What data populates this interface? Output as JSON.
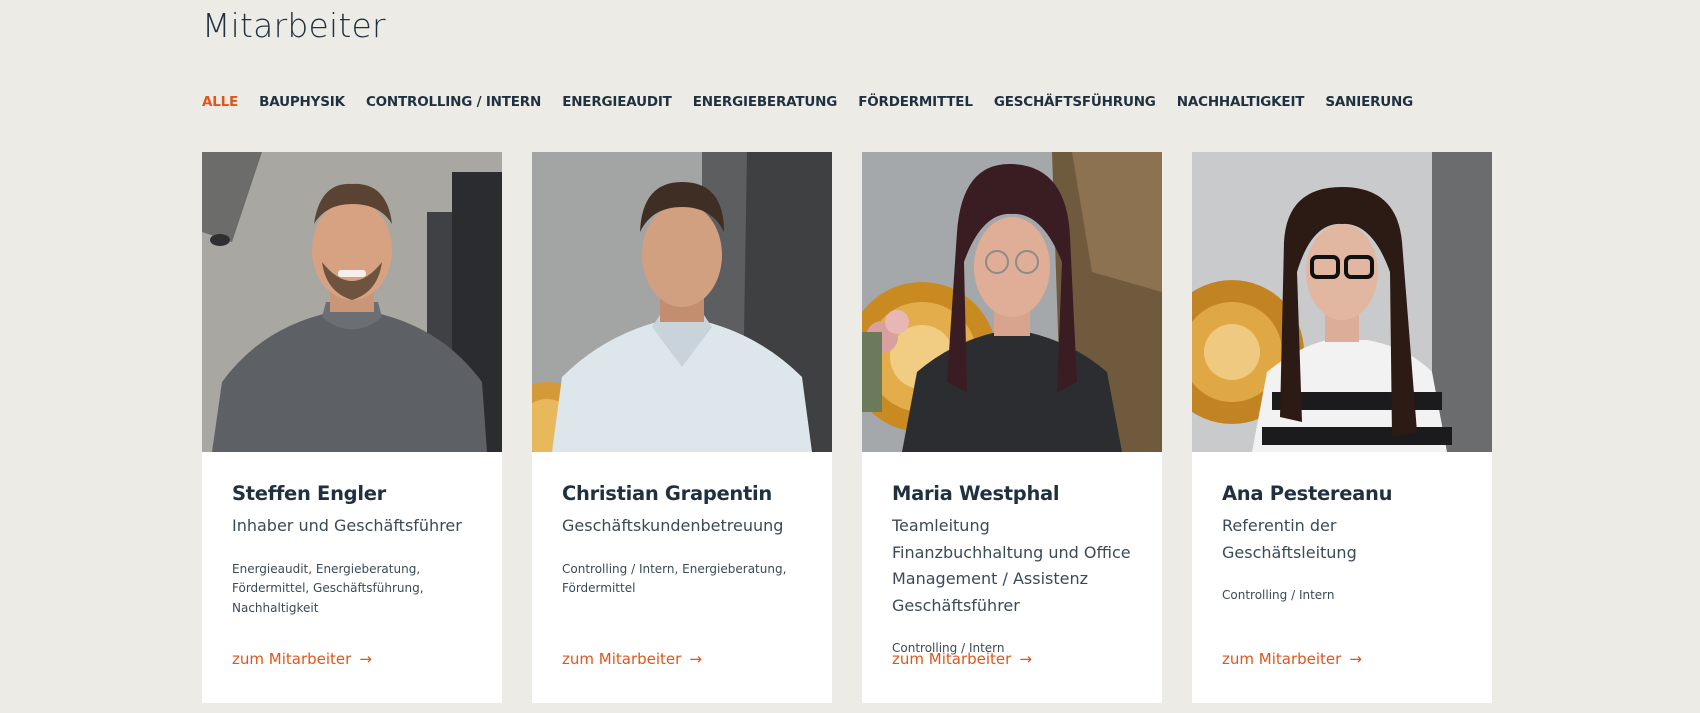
{
  "page": {
    "title": "Mitarbeiter"
  },
  "filters": [
    {
      "label": "ALLE",
      "active": true
    },
    {
      "label": "BAUPHYSIK"
    },
    {
      "label": "CONTROLLING / INTERN"
    },
    {
      "label": "ENERGIEAUDIT"
    },
    {
      "label": "ENERGIEBERATUNG"
    },
    {
      "label": "FÖRDERMITTEL"
    },
    {
      "label": "GESCHÄFTSFÜHRUNG"
    },
    {
      "label": "NACHHALTIGKEIT"
    },
    {
      "label": "SANIERUNG"
    }
  ],
  "employees": [
    {
      "name": "Steffen Engler",
      "role": "Inhaber und Geschäftsführer",
      "tags": "Energieaudit, Energieberatung, Fördermittel, Geschäftsführung, Nachhaltigkeit",
      "link": "zum Mitarbeiter"
    },
    {
      "name": "Christian Grapentin",
      "role": "Geschäftskundenbetreuung",
      "tags": "Controlling / Intern, Energieberatung, Fördermittel",
      "link": "zum Mitarbeiter"
    },
    {
      "name": "Maria Westphal",
      "role": "Teamleitung Finanzbuchhaltung und Office Management / Assistenz Geschäftsführer",
      "tags": "Controlling / Intern",
      "link": "zum Mitarbeiter"
    },
    {
      "name": "Ana Pestereanu",
      "role": "Referentin der Geschäftsleitung",
      "tags": "Controlling / Intern",
      "link": "zum Mitarbeiter"
    }
  ],
  "colors": {
    "accent": "#e0561a",
    "text": "#1f3140",
    "background": "#edebe6"
  }
}
